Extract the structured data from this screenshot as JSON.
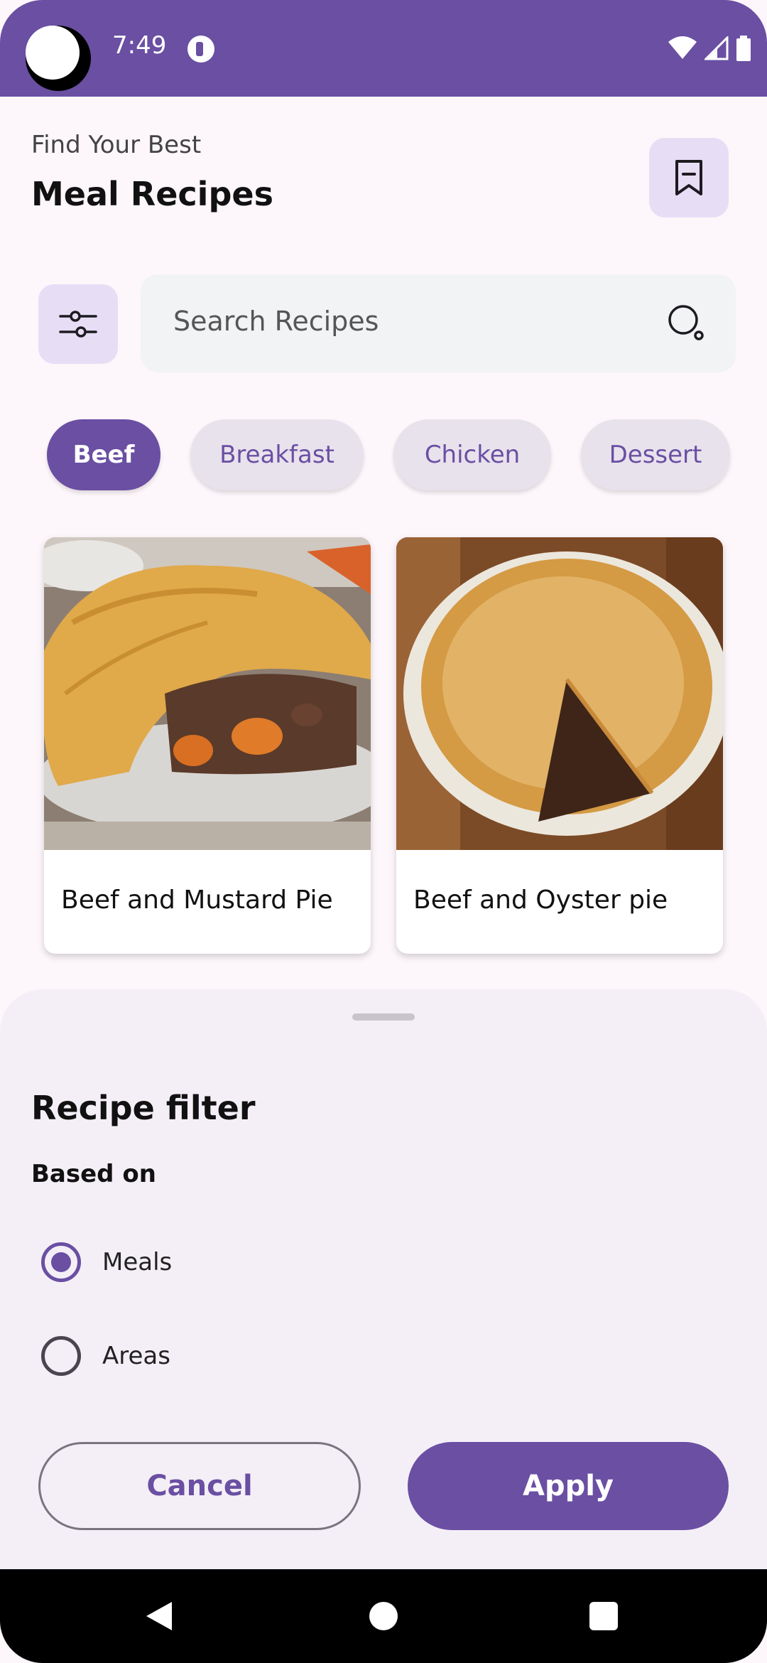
{
  "status_bar": {
    "time": "7:49",
    "icons": [
      "wifi-icon",
      "cell-signal-icon",
      "battery-icon"
    ]
  },
  "header": {
    "subtitle": "Find Your Best",
    "title": "Meal Recipes",
    "bookmark_icon": "bookmark-icon"
  },
  "search": {
    "placeholder": "Search Recipes",
    "filter_icon": "sliders-icon",
    "search_icon": "search-icon"
  },
  "categories": [
    {
      "label": "Beef",
      "active": true
    },
    {
      "label": "Breakfast",
      "active": false
    },
    {
      "label": "Chicken",
      "active": false
    },
    {
      "label": "Dessert",
      "active": false
    }
  ],
  "recipes": [
    {
      "title": "Beef and Mustard Pie"
    },
    {
      "title": "Beef and Oyster pie"
    }
  ],
  "filter_sheet": {
    "title": "Recipe filter",
    "section_label": "Based on",
    "options": [
      {
        "label": "Meals",
        "selected": true
      },
      {
        "label": "Areas",
        "selected": false
      }
    ],
    "cancel_label": "Cancel",
    "apply_label": "Apply"
  },
  "colors": {
    "primary": "#6a4fa3",
    "chip_bg": "#e8e2ec",
    "sheet_bg": "#f4eff6"
  }
}
